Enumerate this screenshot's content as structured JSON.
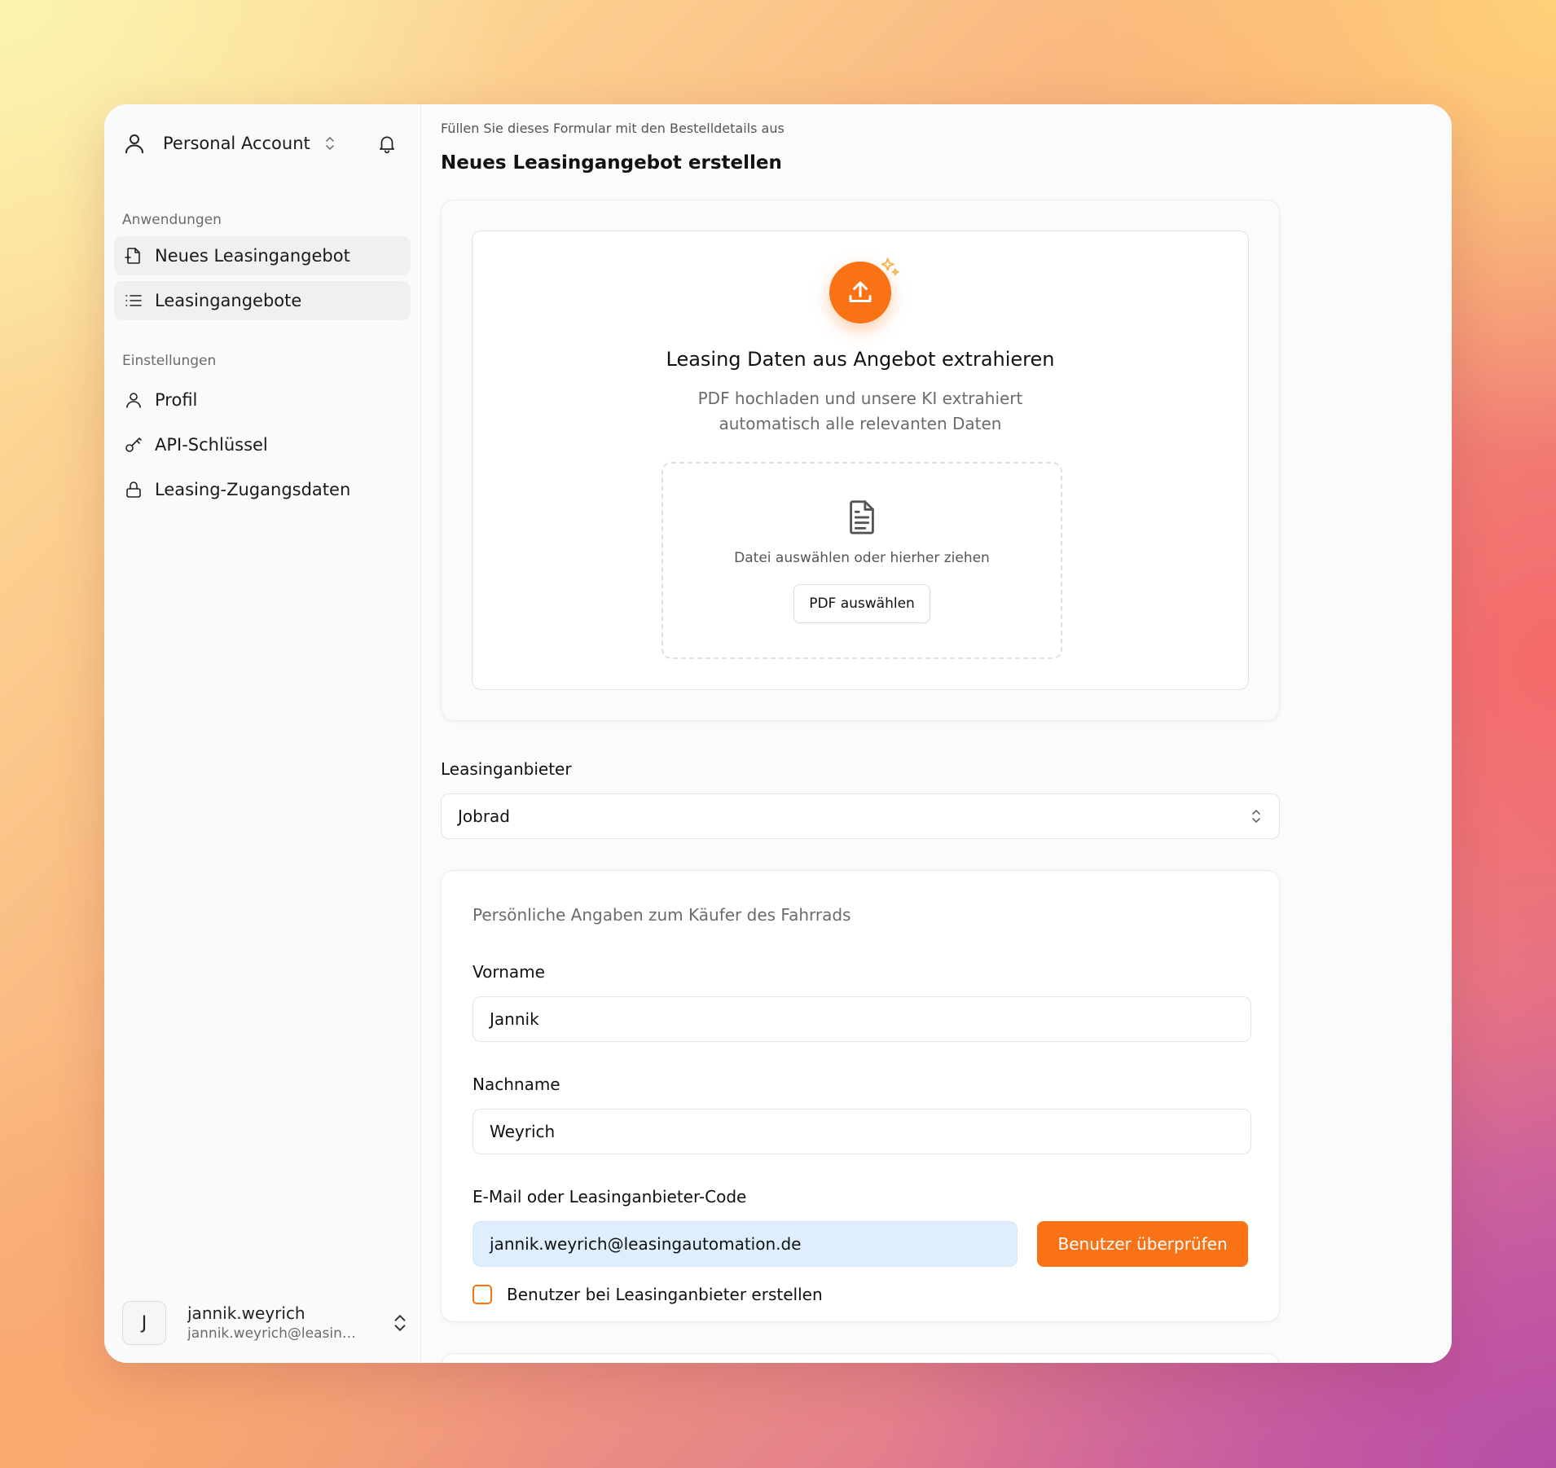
{
  "sidebar": {
    "account_name": "Personal Account",
    "groups": [
      {
        "label": "Anwendungen"
      },
      {
        "label": "Einstellungen"
      }
    ],
    "apps": [
      {
        "label": "Neues Leasingangebot",
        "icon": "file-plus-icon"
      },
      {
        "label": "Leasingangebote",
        "icon": "list-icon"
      }
    ],
    "settings": [
      {
        "label": "Profil",
        "icon": "user-icon"
      },
      {
        "label": "API-Schlüssel",
        "icon": "key-icon"
      },
      {
        "label": "Leasing-Zugangsdaten",
        "icon": "lock-icon"
      }
    ],
    "user": {
      "initial": "J",
      "name": "jannik.weyrich",
      "email": "jannik.weyrich@leasing..."
    }
  },
  "main": {
    "breadcrumb": "Füllen Sie dieses Formular mit den Bestelldetails aus",
    "title": "Neues Leasingangebot erstellen",
    "upload": {
      "title": "Leasing Daten aus Angebot extrahieren",
      "desc_line1": "PDF hochladen und unsere KI extrahiert",
      "desc_line2": "automatisch alle relevanten Daten",
      "drop_text": "Datei auswählen oder hierher ziehen",
      "button_label": "PDF auswählen"
    },
    "provider": {
      "label": "Leasinganbieter",
      "selected": "Jobrad"
    },
    "person": {
      "hint": "Persönliche Angaben zum Käufer des Fahrrads",
      "firstname_label": "Vorname",
      "firstname_value": "Jannik",
      "lastname_label": "Nachname",
      "lastname_value": "Weyrich",
      "email_label": "E-Mail oder Leasinganbieter-Code",
      "email_value": "jannik.weyrich@leasingautomation.de",
      "check_button": "Benutzer überprüfen",
      "create_checkbox_label": "Benutzer bei Leasinganbieter erstellen",
      "create_checked": false
    }
  },
  "colors": {
    "accent": "#f97316",
    "email_field_bg": "#dfeefc"
  }
}
